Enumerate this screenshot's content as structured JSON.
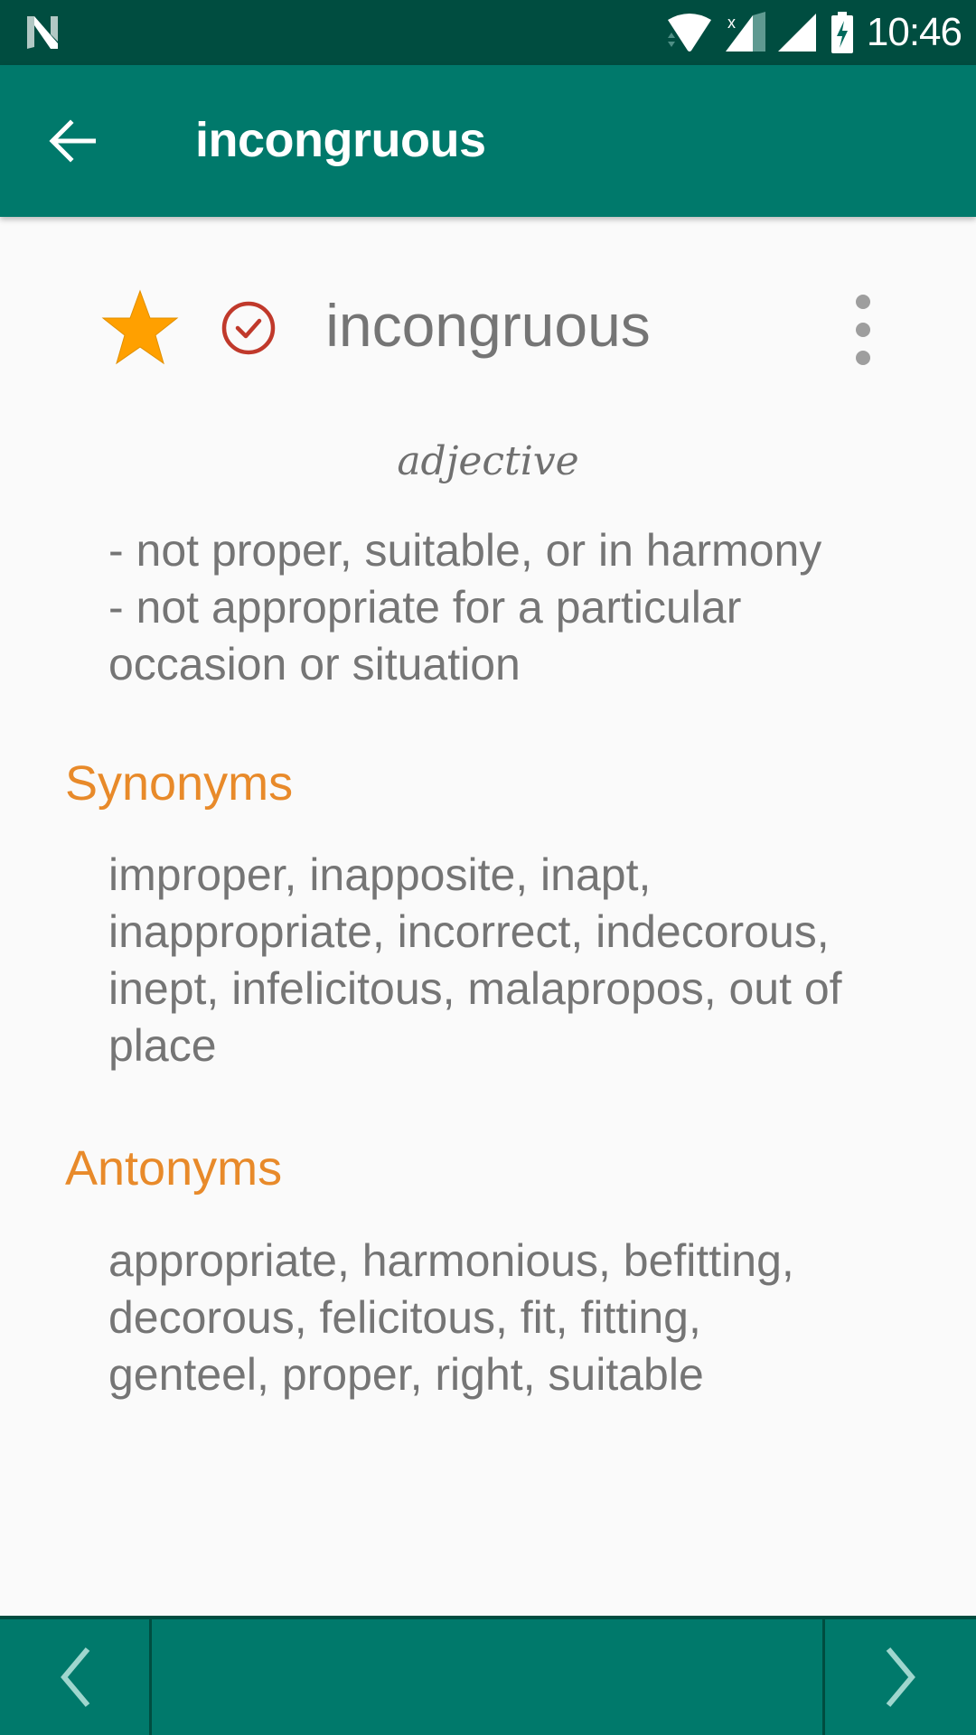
{
  "status_bar": {
    "time": "10:46",
    "icons": [
      "notification-n-icon",
      "wifi-icon",
      "signal-no-data-icon",
      "signal-icon",
      "battery-charging-icon"
    ]
  },
  "app_bar": {
    "back_icon": "arrow-left-icon",
    "title": "incongruous"
  },
  "entry": {
    "word": "incongruous",
    "favorite_icon": "star-icon",
    "favorited": true,
    "learned_icon": "check-circle-icon",
    "more_icon": "more-vert-icon",
    "part_of_speech": "adjective",
    "definitions": [
      "- not proper, suitable, or in harmony",
      "- not appropriate for a particular occasion or situation"
    ],
    "synonyms_title": "Synonyms",
    "synonyms": "improper, inapposite, inapt, inappropriate, incorrect, indecorous, inept, infelicitous, malapropos, out of place",
    "antonyms_title": "Antonyms",
    "antonyms": "appropriate, harmonious, befitting, decorous, felicitous, fit, fitting, genteel, proper, right, suitable"
  },
  "bottom_bar": {
    "prev_icon": "chevron-left-icon",
    "next_icon": "chevron-right-icon"
  },
  "colors": {
    "status_bar": "#004d40",
    "primary": "#00796b",
    "accent": "#e88a2a",
    "star": "#ffa000",
    "check": "#c0392b",
    "text": "#757575"
  }
}
